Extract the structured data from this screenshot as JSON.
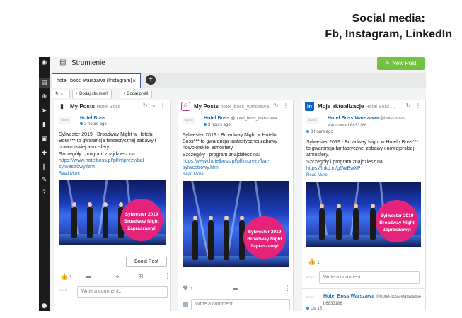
{
  "headline": {
    "line1": "Social media:",
    "line2": "Fb, Instagram, LinkedIn"
  },
  "topbar": {
    "title": "Strumienie",
    "new_post": "New Post"
  },
  "tab": {
    "label": "hotel_boss_warszawa (Instagram)",
    "close": "×",
    "add": "+"
  },
  "toolbar": {
    "refresh": "↻ ⌄",
    "add_stream": "+ Dodaj strumień",
    "add_profile": "+ Dodaj profil"
  },
  "columns": [
    {
      "title": "My Posts",
      "subtitle": "Hotel Boss",
      "actions": "↻ ⌕ ⋮",
      "author": "Hotel Boss",
      "handle": "",
      "time": "3 hours ago",
      "text": "Sylwester 2019 - Broadway Night w Hotelu Boss*** to gwarancja fantastycznej zabawy i nowojorskiej atmosfery.",
      "text2": "Szczegóły i program znajdziesz na:",
      "link": "https://www.hotelboss.pl/pl/imprezy/bal-sylwestrowy.htm",
      "read_more": "Read More",
      "badge": [
        "Sylwester 2019",
        "Broadway Night",
        "Zapraszamy!"
      ],
      "boost": "Boost Post",
      "likes": "3",
      "comment_placeholder": "Write a comment..."
    },
    {
      "title": "My Posts",
      "subtitle": "hotel_boss_warszawa",
      "actions": "↻ ⋮",
      "author": "Hotel Boss",
      "handle": "@hotel_boss_warszawa",
      "time": "3 hours ago",
      "text": "Sylwester 2019 - Broadway Night w Hotelu Boss*** to gwarancja fantastycznej zabawy i nowojorskiej atmosfery.",
      "text2": "Szczegóły i program znajdziesz na:",
      "link": "https://www.hotelboss.pl/pl/imprezy/bal-sylwestrowy.htm",
      "read_more": "Read More",
      "badge": [
        "Sylwester 2019",
        "Broadway Night",
        "Zapraszamy!"
      ],
      "likes": "1",
      "comment_placeholder": "Write a comment..."
    },
    {
      "title": "Moje aktualizacje",
      "subtitle": "Hotel Boss ...",
      "actions": "↻ ⋮",
      "author": "Hotel Boss Warszawa",
      "handle": "@hotel-boss-warszawa-b6833186",
      "time": "3 hours ago",
      "text": "Sylwester 2019 - Broadway Night w Hotelu Boss*** to gwarancja fantastycznej zabawy i nowojorskiej atmosfery.",
      "text2": "Szczegóły i program znajdziesz na:",
      "link": "https://lnkd.in/g6WBwXP",
      "read_more": "Read More",
      "badge": [
        "Sylwester 2019",
        "Broadway Night",
        "Zapraszamy!"
      ],
      "likes": "1",
      "comment_placeholder": "Write a comment...",
      "next_author": "Hotel Boss Warszawa",
      "next_handle": "@hotel-boss-warszawa-b6833186",
      "next_time": "Lis 15"
    }
  ],
  "colors": {
    "accent_green": "#72c142",
    "link_blue": "#1a6fb5",
    "badge_pink": "#e5237b",
    "sidebar": "#1c1c1c",
    "tab_border": "#3f51b5"
  }
}
